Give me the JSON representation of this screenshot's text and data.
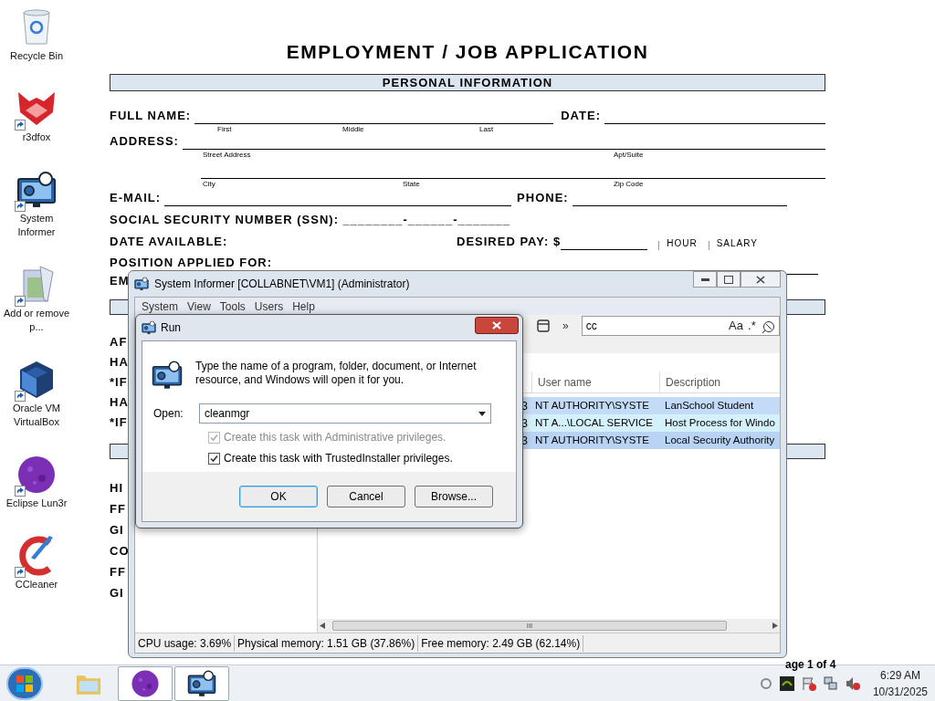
{
  "desktop_icons": [
    {
      "kind": "recycle",
      "label": "Recycle Bin",
      "shortcut": false
    },
    {
      "kind": "fox",
      "label": "r3dfox",
      "shortcut": true
    },
    {
      "kind": "monitor",
      "label": "System Informer",
      "shortcut": true
    },
    {
      "kind": "installer",
      "label": "Add or remove p...",
      "shortcut": true
    },
    {
      "kind": "cube",
      "label": "Oracle VM VirtualBox",
      "shortcut": true
    },
    {
      "kind": "planet",
      "label": "Eclipse Lun3r",
      "shortcut": true
    },
    {
      "kind": "cleaner",
      "label": "CCleaner",
      "shortcut": true
    }
  ],
  "document": {
    "title": "EMPLOYMENT / JOB APPLICATION",
    "section": "PERSONAL INFORMATION",
    "full_name": "FULL NAME:",
    "name_parts": [
      "First",
      "Middle",
      "Last"
    ],
    "date": "DATE:",
    "address": "ADDRESS:",
    "address_parts_1": [
      "Street Address",
      "Apt/Suite"
    ],
    "address_parts_2": [
      "City",
      "State",
      "Zip Code"
    ],
    "email": "E-MAIL:",
    "phone": "PHONE:",
    "ssn": "SOCIAL SECURITY NUMBER (SSN): ________-______-_______",
    "date_available": "DATE AVAILABLE:",
    "desired_pay": "DESIRED PAY: $",
    "pay_options": [
      "HOUR",
      "SALARY"
    ],
    "position": "POSITION APPLIED FOR:",
    "left_fragments_1": [
      "EM"
    ],
    "left_fragments_2": [
      "AF",
      "HA",
      "*IF",
      "HA",
      "*IF"
    ],
    "left_fragments_3": [
      "HI",
      "FF",
      "GI",
      "CO",
      "FF",
      "GI"
    ],
    "page": "age 1 of 4"
  },
  "system_informer": {
    "title": "System Informer [COLLABNET\\VM1] (Administrator)",
    "menu": [
      "System",
      "View",
      "Tools",
      "Users",
      "Help"
    ],
    "overflow": "»",
    "search": {
      "value": "cc"
    },
    "search_options": [
      "Aa",
      ".*"
    ],
    "columns": [
      "User name",
      "Description"
    ],
    "rows": [
      {
        "column_1": "3",
        "user": "NT AUTHORITY\\SYSTE",
        "description": "LanSchool Student",
        "color": "#c4dbf7"
      },
      {
        "column_1": "3",
        "user": "NT A...\\LOCAL SERVICE",
        "description": "Host Process for Windo",
        "color": "#d4f0fb"
      },
      {
        "column_1": "3",
        "user": "NT AUTHORITY\\SYSTE",
        "description": "Local Security Authority",
        "color": "#b9d3f5"
      }
    ],
    "scroll_grip": "III",
    "status": [
      "CPU usage: 3.69%",
      "Physical memory: 1.51 GB (37.86%)",
      "Free memory: 2.49 GB (62.14%)"
    ]
  },
  "run_dialog": {
    "title": "Run",
    "message": "Type the name of a program, folder, document, or Internet resource, and Windows will open it for you.",
    "open_label": "Open:",
    "value": "cleanmgr",
    "options": [
      {
        "label": "Create this task with Administrative privileges.",
        "checked": true,
        "disabled": true
      },
      {
        "label": "Create this task with TrustedInstaller privileges.",
        "checked": true,
        "disabled": false
      }
    ],
    "buttons": [
      {
        "label": "OK",
        "default": true
      },
      {
        "label": "Cancel",
        "default": false
      },
      {
        "label": "Browse...",
        "default": false
      }
    ]
  },
  "taskbar": {
    "items": [
      {
        "kind": "folder",
        "active": false
      },
      {
        "kind": "planet",
        "active": true
      },
      {
        "kind": "monitor",
        "active": true
      }
    ],
    "time": "6:29 AM",
    "date": "10/31/2025"
  }
}
